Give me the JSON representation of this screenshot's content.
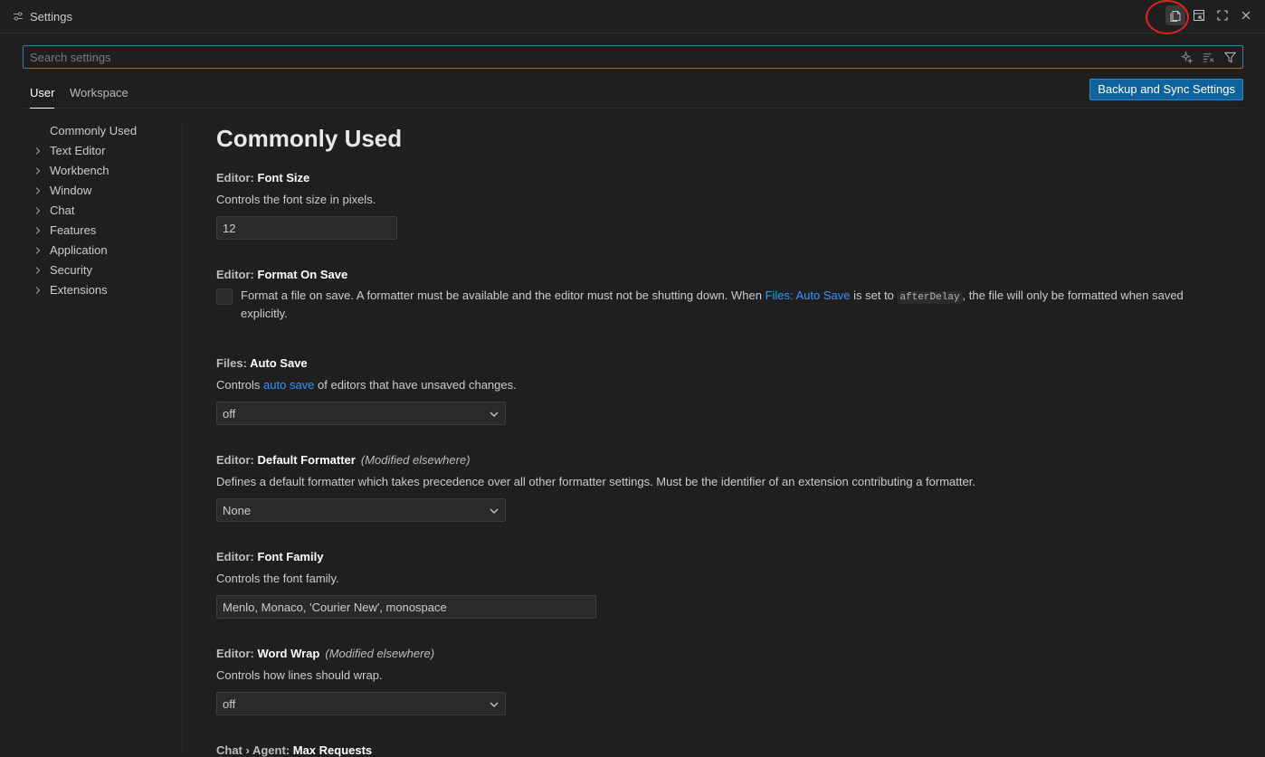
{
  "window": {
    "title": "Settings"
  },
  "search": {
    "placeholder": "Search settings"
  },
  "tabs": {
    "user": "User",
    "workspace": "Workspace"
  },
  "sync_button": "Backup and Sync Settings",
  "toc": [
    {
      "label": "Commonly Used",
      "expandable": false
    },
    {
      "label": "Text Editor",
      "expandable": true
    },
    {
      "label": "Workbench",
      "expandable": true
    },
    {
      "label": "Window",
      "expandable": true
    },
    {
      "label": "Chat",
      "expandable": true
    },
    {
      "label": "Features",
      "expandable": true
    },
    {
      "label": "Application",
      "expandable": true
    },
    {
      "label": "Security",
      "expandable": true
    },
    {
      "label": "Extensions",
      "expandable": true
    }
  ],
  "content": {
    "heading": "Commonly Used",
    "font_size": {
      "category": "Editor: ",
      "name": "Font Size",
      "description": "Controls the font size in pixels.",
      "value": "12"
    },
    "format_on_save": {
      "category": "Editor: ",
      "name": "Format On Save",
      "desc_part1": "Format a file on save. A formatter must be available and the editor must not be shutting down. When ",
      "desc_link": "Files: Auto Save",
      "desc_part2": " is set to ",
      "desc_code": "afterDelay",
      "desc_part3": ", the file will only be formatted when saved explicitly.",
      "checked": false
    },
    "auto_save": {
      "category": "Files: ",
      "name": "Auto Save",
      "desc_part1": "Controls ",
      "desc_link": "auto save",
      "desc_part2": " of editors that have unsaved changes.",
      "value": "off"
    },
    "default_formatter": {
      "category": "Editor: ",
      "name": "Default Formatter",
      "modified": "(Modified elsewhere)",
      "description": "Defines a default formatter which takes precedence over all other formatter settings. Must be the identifier of an extension contributing a formatter.",
      "value": "None"
    },
    "font_family": {
      "category": "Editor: ",
      "name": "Font Family",
      "description": "Controls the font family.",
      "value": "Menlo, Monaco, 'Courier New', monospace"
    },
    "word_wrap": {
      "category": "Editor: ",
      "name": "Word Wrap",
      "modified": "(Modified elsewhere)",
      "description": "Controls how lines should wrap.",
      "value": "off"
    },
    "max_requests": {
      "category": "Chat › Agent: ",
      "name": "Max Requests"
    }
  },
  "colors": {
    "accent": "#0e639c",
    "link": "#3794ff",
    "annotation": "#e0241d"
  },
  "icons": {
    "title": "settings-sliders-icon",
    "open_json": "open-settings-json-icon",
    "split": "split-editor-icon",
    "maximize": "maximize-icon",
    "close": "close-icon",
    "sparkle": "sparkle-icon",
    "clear": "clear-filter-icon",
    "filter": "filter-icon"
  }
}
